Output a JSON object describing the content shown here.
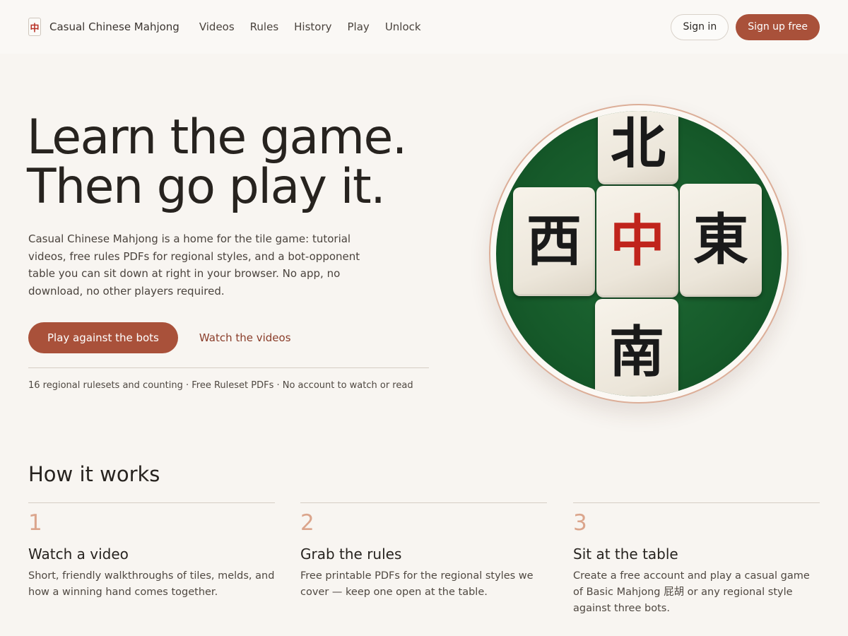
{
  "header": {
    "logo_glyph": "中",
    "brand": "Casual Chinese Mahjong",
    "nav": [
      "Videos",
      "Rules",
      "History",
      "Play",
      "Unlock"
    ],
    "sign_in": "Sign in",
    "sign_up": "Sign up free"
  },
  "hero": {
    "title_line1": "Learn the game.",
    "title_line2": "Then go play it.",
    "description": "Casual Chinese Mahjong is a home for the tile game: tutorial videos, free rules PDFs for regional styles, and a bot-opponent table you can sit down at right in your browser. No app, no download, no other players required.",
    "primary_cta": "Play against the bots",
    "secondary_cta": "Watch the videos",
    "meta": "16 regional rulesets and counting · Free Ruleset PDFs · No account to watch or read",
    "tiles": {
      "north": "北",
      "west": "西",
      "center": "中",
      "east": "東",
      "south": "南"
    }
  },
  "how": {
    "title": "How it works",
    "steps": [
      {
        "num": "1",
        "title": "Watch a video",
        "text": "Short, friendly walkthroughs of tiles, melds, and how a winning hand comes together."
      },
      {
        "num": "2",
        "title": "Grab the rules",
        "text": "Free printable PDFs for the regional styles we cover — keep one open at the table."
      },
      {
        "num": "3",
        "title": "Sit at the table",
        "text": "Create a free account and play a casual game of Basic Mahjong 屁胡 or any regional style against three bots."
      }
    ]
  },
  "colors": {
    "accent": "#a9513a",
    "felt": "#165a2a",
    "red_glyph": "#c0241c",
    "step_number": "#dba58c"
  }
}
